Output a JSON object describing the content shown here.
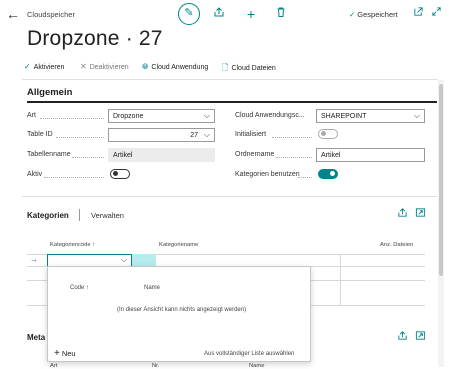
{
  "header": {
    "breadcrumb": "Cloudspeicher",
    "title": "Dropzone · 27",
    "saved_label": "Gespeichert"
  },
  "actions": [
    {
      "label": "Aktivieren",
      "icon": "check-icon",
      "enabled": true
    },
    {
      "label": "Deaktivieren",
      "icon": "x-icon",
      "enabled": false
    },
    {
      "label": "Cloud Anwendung",
      "icon": "globe-icon",
      "enabled": true
    },
    {
      "label": "Cloud Dateien",
      "icon": "document-icon",
      "enabled": true
    }
  ],
  "general": {
    "title": "Allgemein",
    "art_label": "Art",
    "art_value": "Dropzone",
    "table_id_label": "Table ID",
    "table_id_value": "27",
    "table_name_label": "Tabellenname",
    "table_name_value": "Artikel",
    "active_label": "Aktiv",
    "active_value": false,
    "cloud_app_label": "Cloud Anwendungsc...",
    "cloud_app_value": "SHAREPOINT",
    "initialized_label": "Initialisiert",
    "initialized_value": false,
    "folder_label": "Ordnername",
    "folder_value": "Artikel",
    "use_categories_label": "Kategorien benutzen",
    "use_categories_value": true
  },
  "categories": {
    "tab_label": "Kategorien",
    "manage_label": "Verwalten",
    "col_code": "Kategoriencode ↑",
    "col_name": "Kategoriename",
    "col_files": "Anz. Dateien"
  },
  "lookup": {
    "col_code": "Code ↑",
    "col_name": "Name",
    "empty_text": "(In dieser Ansicht kann nichts angezeigt werden)",
    "new_label": "Neu",
    "full_list_label": "Aus vollständiger Liste auswählen"
  },
  "meta": {
    "title_partial": "Meta",
    "col_art": "Art",
    "col_nr": "Nr.",
    "col_name": "Name"
  },
  "colors": {
    "accent": "#008489"
  }
}
